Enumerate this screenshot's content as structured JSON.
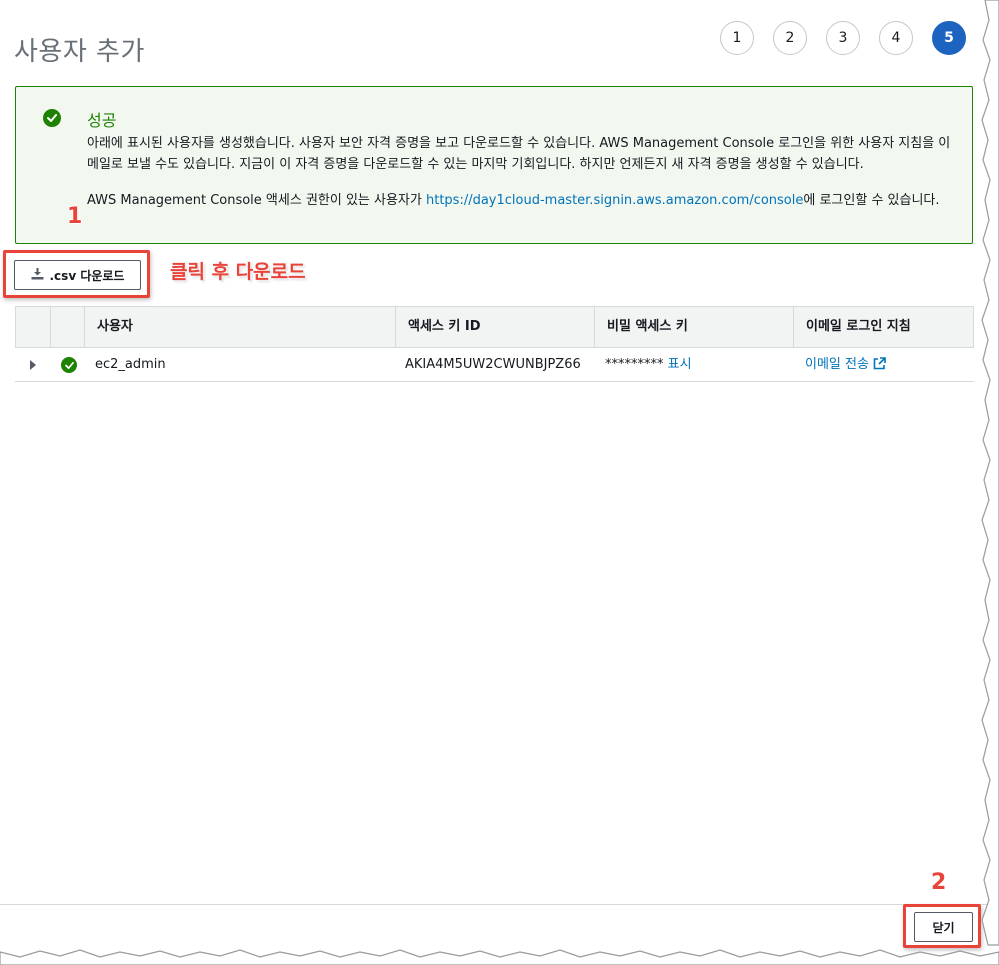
{
  "page": {
    "title": "사용자 추가"
  },
  "steps": [
    {
      "label": "1",
      "active": false
    },
    {
      "label": "2",
      "active": false
    },
    {
      "label": "3",
      "active": false
    },
    {
      "label": "4",
      "active": false
    },
    {
      "label": "5",
      "active": true
    }
  ],
  "success": {
    "title": "성공",
    "line1": "아래에 표시된 사용자를 생성했습니다. 사용자 보안 자격 증명을 보고 다운로드할 수 있습니다. AWS Management Console 로그인을 위한 사용자 지침을 이메일로 보낼 수도 있습니다. 지금이 이 자격 증명을 다운로드할 수 있는 마지막 기회입니다. 하지만 언제든지 새 자격 증명을 생성할 수 있습니다.",
    "line2_prefix": "AWS Management Console 액세스 권한이 있는 사용자가 ",
    "line2_link": "https://day1cloud-master.signin.aws.amazon.com/console",
    "line2_suffix": "에 로그인할 수 있습니다."
  },
  "annotations": {
    "step1_num": "1",
    "step1_text": "클릭 후 다운로드",
    "step2_num": "2"
  },
  "toolbar": {
    "csv_download_label": ".csv 다운로드"
  },
  "table": {
    "headers": {
      "user": "사용자",
      "access_key_id": "액세스 키 ID",
      "secret_key": "비밀 액세스 키",
      "email_instructions": "이메일 로그인 지침"
    },
    "rows": [
      {
        "user": "ec2_admin",
        "access_key_id": "AKIA4M5UW2CWUNBJPZ66",
        "secret_masked": "*********",
        "secret_show_label": "표시",
        "email_link": "이메일 전송"
      }
    ]
  },
  "footer": {
    "close_label": "닫기"
  },
  "colors": {
    "accent": "#1c64c0",
    "success": "#1d8102",
    "link": "#0073bb",
    "annotation": "#e8443a"
  }
}
